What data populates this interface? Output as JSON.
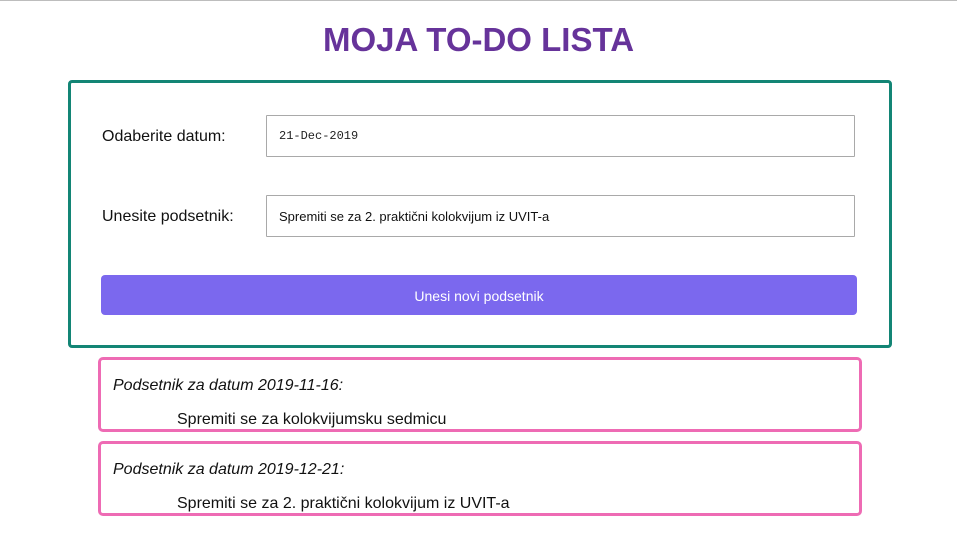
{
  "page": {
    "title": "MOJA TO-DO LISTA"
  },
  "form": {
    "date_label": "Odaberite datum:",
    "date_value": "21-Dec-2019",
    "reminder_label": "Unesite podsetnik:",
    "reminder_value": "Spremiti se za 2. praktični kolokvijum iz UVIT-a",
    "submit_label": "Unesi novi podsetnik"
  },
  "reminders": [
    {
      "heading": "Podsetnik za datum 2019-11-16:",
      "text": "Spremiti se za kolokvijumsku sedmicu"
    },
    {
      "heading": "Podsetnik za datum 2019-12-21:",
      "text": "Spremiti se za 2. praktični kolokvijum iz UVIT-a"
    }
  ],
  "colors": {
    "title": "#66339a",
    "form_border": "#138575",
    "button": "#7b68ee",
    "reminder_border": "#ee6bb4"
  }
}
